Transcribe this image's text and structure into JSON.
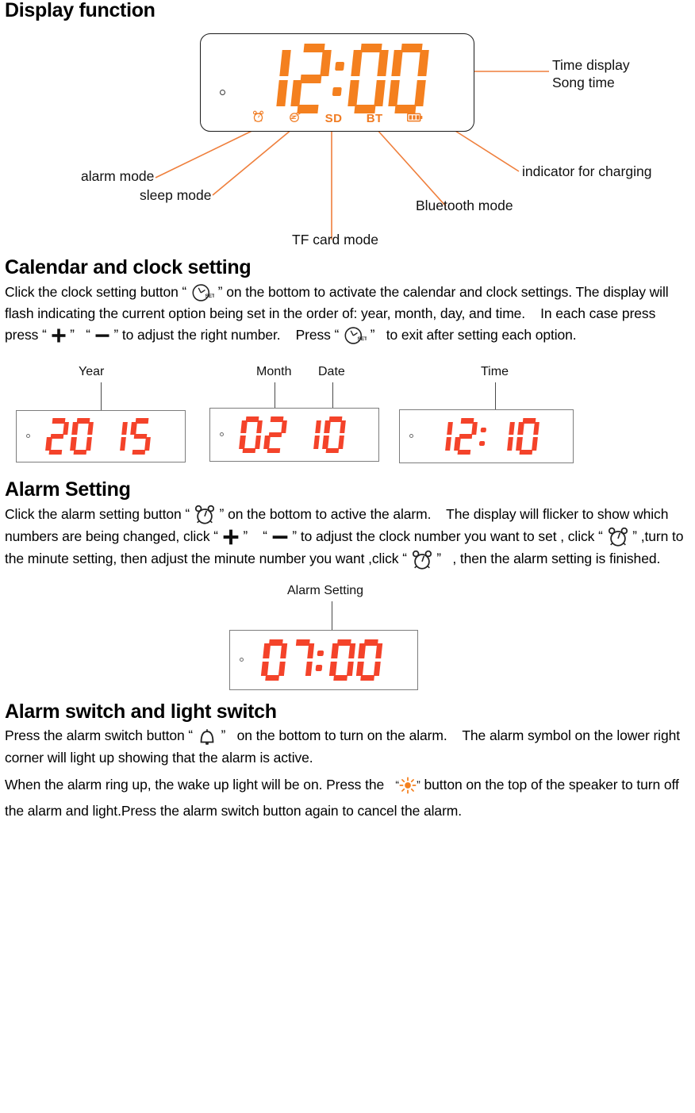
{
  "doc": {
    "sections": [
      {
        "id": "display_function",
        "heading": "Display function"
      },
      {
        "id": "calendar_clock",
        "heading": "Calendar and clock setting"
      },
      {
        "id": "alarm_setting",
        "heading": "Alarm Setting"
      },
      {
        "id": "alarm_light_switch",
        "heading": "Alarm switch and light switch"
      }
    ]
  },
  "display_function": {
    "heading": "Display function",
    "lcd": {
      "time_digits": [
        "1",
        "2",
        ":",
        "0",
        "0"
      ],
      "time_value": "12:00",
      "indicators": [
        {
          "name": "alarm-indicator-icon",
          "kind": "icon",
          "label": "alarm"
        },
        {
          "name": "sleep-indicator-icon",
          "kind": "icon",
          "label": "sleep"
        },
        {
          "name": "sd-indicator",
          "kind": "text",
          "label": "SD"
        },
        {
          "name": "bt-indicator",
          "kind": "text",
          "label": "BT"
        },
        {
          "name": "battery-indicator-icon",
          "kind": "icon",
          "label": "battery"
        }
      ]
    },
    "callouts": {
      "time_display_line1": "Time display",
      "time_display_line2": "Song time",
      "indicator_for_charging": "indicator for charging",
      "alarm_mode": "alarm mode",
      "sleep_mode": "sleep mode",
      "tf_card_mode": "TF card mode",
      "bluetooth_mode": "Bluetooth mode"
    }
  },
  "calendar_clock": {
    "heading": "Calendar and clock setting",
    "paragraph": {
      "p1": "Click the clock setting button",
      "p2": "on the bottom to activate the calendar and clock settings. The display will flash indicating the current option being set in the order of: year, month, day, and time.",
      "p3": "In each case press press",
      "p4": "to adjust the right number.",
      "p5": "Press",
      "p6": "to exit after setting each option.",
      "quote_open": "“",
      "quote_close": "”",
      "plus_symbol": "+",
      "minus_symbol": "—"
    },
    "panels": [
      {
        "id": "year-panel",
        "caption": [
          "Year"
        ],
        "digits": "2015",
        "display": "20 15"
      },
      {
        "id": "month-date-panel",
        "caption": [
          "Month",
          "Date"
        ],
        "digits": "0210",
        "display": "02 10"
      },
      {
        "id": "time-panel",
        "caption": [
          "Time"
        ],
        "digits": "1210",
        "display": "12:10"
      }
    ]
  },
  "alarm_setting": {
    "heading": "Alarm Setting",
    "paragraph": {
      "p1": "Click the alarm setting button",
      "p2": "on the bottom to active the alarm.",
      "p3": "The display will flicker to show which numbers are being changed, click",
      "p4": "to adjust the clock number you want to set , click",
      "p5": ",turn to the minute setting, then adjust the minute number you want ,click",
      "p6": ", then the alarm setting is finished.",
      "plus_symbol": "+",
      "minus_symbol": "—"
    },
    "panel": {
      "id": "alarm-setting-panel",
      "caption": "Alarm Setting",
      "digits": "0700",
      "display": "07:00"
    }
  },
  "alarm_light_switch": {
    "heading": "Alarm switch and light switch",
    "paragraph": {
      "p1": "Press the alarm switch button",
      "p2": "on the bottom to turn on the alarm.",
      "p3": "The alarm symbol on the lower right corner will light up showing that the alarm is active.",
      "p4": "When the alarm ring up, the wake up light will be on. Press the",
      "p5": "button on the top of the speaker to turn off the alarm and light.Press the alarm switch button again to cancel the alarm."
    }
  },
  "colors": {
    "led_orange": "#F4801F",
    "led_red": "#F4432A",
    "callout_line": "#EF7F3C",
    "text": "#000000",
    "panel_border": "#7D7D7D",
    "lcd_border": "#1A1A1A",
    "sun_icon": "#F4801F"
  }
}
